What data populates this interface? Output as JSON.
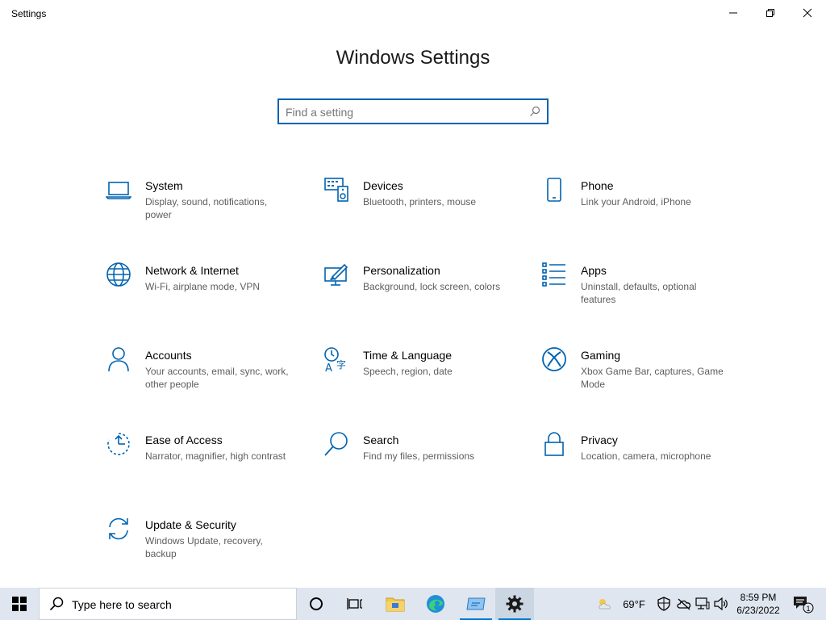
{
  "window": {
    "title": "Settings",
    "minimize_icon": "minimize-icon",
    "maximize_icon": "restore-icon",
    "close_icon": "close-icon"
  },
  "header": {
    "title": "Windows Settings",
    "search_placeholder": "Find a setting",
    "search_value": ""
  },
  "accent_color": "#0063b1",
  "tiles": [
    {
      "title": "System",
      "desc": "Display, sound, notifications, power",
      "icon": "laptop-icon"
    },
    {
      "title": "Devices",
      "desc": "Bluetooth, printers, mouse",
      "icon": "keyboard-speaker-icon"
    },
    {
      "title": "Phone",
      "desc": "Link your Android, iPhone",
      "icon": "phone-icon"
    },
    {
      "title": "Network & Internet",
      "desc": "Wi-Fi, airplane mode, VPN",
      "icon": "globe-icon"
    },
    {
      "title": "Personalization",
      "desc": "Background, lock screen, colors",
      "icon": "paint-monitor-icon"
    },
    {
      "title": "Apps",
      "desc": "Uninstall, defaults, optional features",
      "icon": "apps-list-icon"
    },
    {
      "title": "Accounts",
      "desc": "Your accounts, email, sync, work, other people",
      "icon": "person-icon"
    },
    {
      "title": "Time & Language",
      "desc": "Speech, region, date",
      "icon": "time-language-icon"
    },
    {
      "title": "Gaming",
      "desc": "Xbox Game Bar, captures, Game Mode",
      "icon": "xbox-icon"
    },
    {
      "title": "Ease of Access",
      "desc": "Narrator, magnifier, high contrast",
      "icon": "ease-of-access-icon"
    },
    {
      "title": "Search",
      "desc": "Find my files, permissions",
      "icon": "magnifier-icon"
    },
    {
      "title": "Privacy",
      "desc": "Location, camera, microphone",
      "icon": "lock-icon"
    },
    {
      "title": "Update & Security",
      "desc": "Windows Update, recovery, backup",
      "icon": "sync-arrows-icon"
    }
  ],
  "taskbar": {
    "search_text": "Type here to search",
    "temperature": "69°F",
    "time": "8:59 PM",
    "date": "6/23/2022",
    "notification_count": "1"
  }
}
